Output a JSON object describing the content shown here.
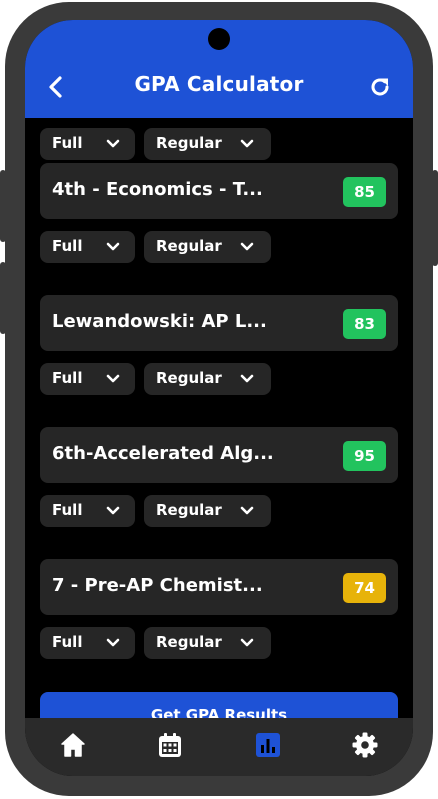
{
  "header": {
    "title": "GPA Calculator"
  },
  "courses": [
    {
      "name": "",
      "grade": "",
      "level": "Full",
      "type": "Regular"
    },
    {
      "name": "4th - Economics - T...",
      "grade": "85",
      "grade_color": "#22c35e",
      "level": "Full",
      "type": "Regular"
    },
    {
      "name": "Lewandowski: AP L...",
      "grade": "83",
      "grade_color": "#22c35e",
      "level": "Full",
      "type": "Regular"
    },
    {
      "name": "6th-Accelerated Alg...",
      "grade": "95",
      "grade_color": "#22c35e",
      "level": "Full",
      "type": "Regular"
    },
    {
      "name": "7 - Pre-AP Chemist...",
      "grade": "74",
      "grade_color": "#e7b30a",
      "level": "Full",
      "type": "Regular"
    }
  ],
  "submit_label": "Get GPA Results",
  "tabs": [
    {
      "icon": "home-icon",
      "active": false
    },
    {
      "icon": "calendar-icon",
      "active": false
    },
    {
      "icon": "bar-chart-icon",
      "active": true
    },
    {
      "icon": "gear-icon",
      "active": false
    }
  ],
  "colors": {
    "accent": "#1e52d6",
    "grade_green": "#22c35e",
    "grade_yellow": "#e7b30a",
    "card_bg": "#262626",
    "screen_bg": "#000000"
  }
}
